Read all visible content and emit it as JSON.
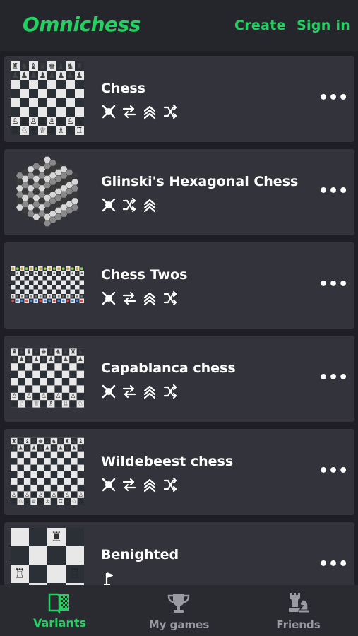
{
  "app": {
    "name": "Omnichess"
  },
  "header": {
    "create_label": "Create",
    "signin_label": "Sign in"
  },
  "colors": {
    "accent": "#23d160",
    "background": "#1e1e24",
    "card": "#33333c",
    "header": "#25252c",
    "inactive": "#9a9aa2"
  },
  "variants": [
    {
      "title": "Chess",
      "board": "square-8x8",
      "tags": [
        "crossed-swords-icon",
        "swap-icon",
        "promotion-icon",
        "shuffle-icon"
      ]
    },
    {
      "title": "Glinski's Hexagonal Chess",
      "board": "hexagonal",
      "tags": [
        "crossed-swords-icon",
        "shuffle-icon",
        "promotion-icon"
      ]
    },
    {
      "title": "Chess Twos",
      "board": "wide-16x8",
      "tags": [
        "crossed-swords-icon",
        "swap-icon",
        "promotion-icon",
        "shuffle-icon"
      ]
    },
    {
      "title": "Capablanca chess",
      "board": "square-10x8",
      "tags": [
        "crossed-swords-icon",
        "swap-icon",
        "promotion-icon",
        "shuffle-icon"
      ]
    },
    {
      "title": "Wildebeest chess",
      "board": "square-11x10",
      "tags": [
        "crossed-swords-icon",
        "swap-icon",
        "promotion-icon",
        "shuffle-icon"
      ]
    },
    {
      "title": "Benighted",
      "board": "square-4x4",
      "tags": [
        "flag-icon"
      ]
    }
  ],
  "more_label": "•••",
  "tabs": [
    {
      "label": "Variants",
      "icon": "variants-book-icon",
      "active": true
    },
    {
      "label": "My games",
      "icon": "trophy-icon",
      "active": false
    },
    {
      "label": "Friends",
      "icon": "chess-pieces-icon",
      "active": false
    }
  ]
}
